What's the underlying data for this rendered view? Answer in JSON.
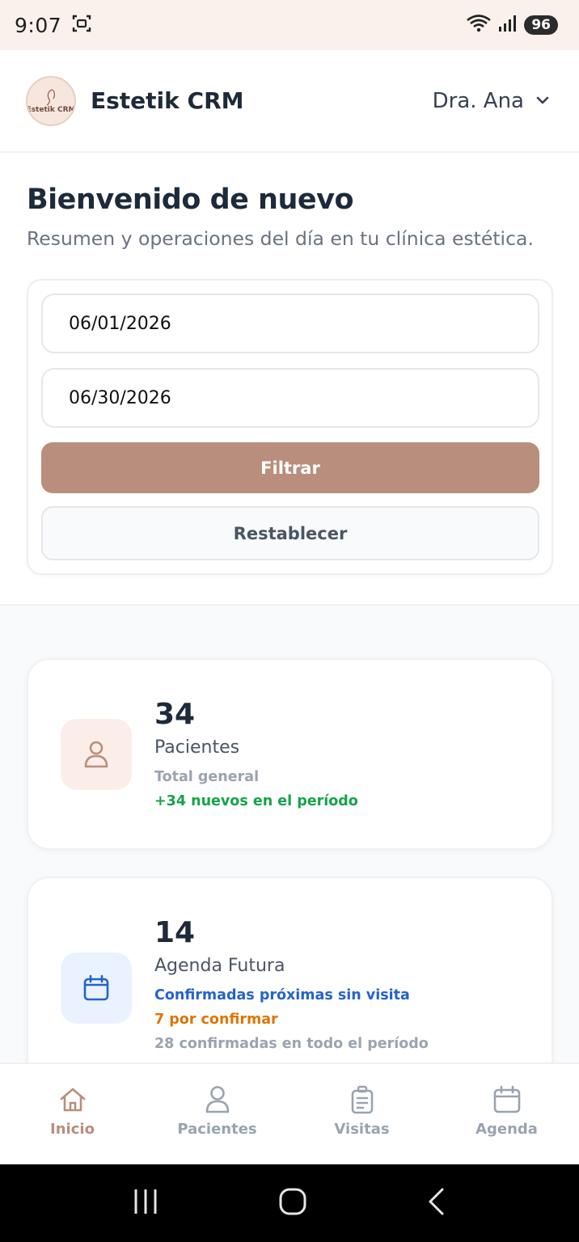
{
  "status_bar": {
    "time": "9:07",
    "battery": "96"
  },
  "header": {
    "logo_text": "Estetik CRM",
    "app_title": "Estetik CRM",
    "user_name": "Dra. Ana"
  },
  "welcome": {
    "title": "Bienvenido de nuevo",
    "subtitle": "Resumen y operaciones del día en tu clínica estética."
  },
  "filters": {
    "start_date": "06/01/2026",
    "end_date": "06/30/2026",
    "filter_label": "Filtrar",
    "reset_label": "Restablecer"
  },
  "stats": [
    {
      "value": "34",
      "label": "Pacientes",
      "line1": "Total general",
      "line2": "+34 nuevos en el período",
      "icon": "user-icon"
    },
    {
      "value": "14",
      "label": "Agenda Futura",
      "line1": "Confirmadas próximas sin visita",
      "line2": "7 por confirmar",
      "line3": "28 confirmadas en todo el período",
      "icon": "calendar-icon"
    }
  ],
  "bottom_nav": [
    {
      "label": "Inicio",
      "icon": "home-icon",
      "active": true
    },
    {
      "label": "Pacientes",
      "icon": "user-icon",
      "active": false
    },
    {
      "label": "Visitas",
      "icon": "clipboard-icon",
      "active": false
    },
    {
      "label": "Agenda",
      "icon": "calendar-icon",
      "active": false
    }
  ],
  "colors": {
    "accent": "#b98e7d",
    "green": "#16a34a",
    "blue": "#2563c9",
    "orange": "#d97706"
  }
}
